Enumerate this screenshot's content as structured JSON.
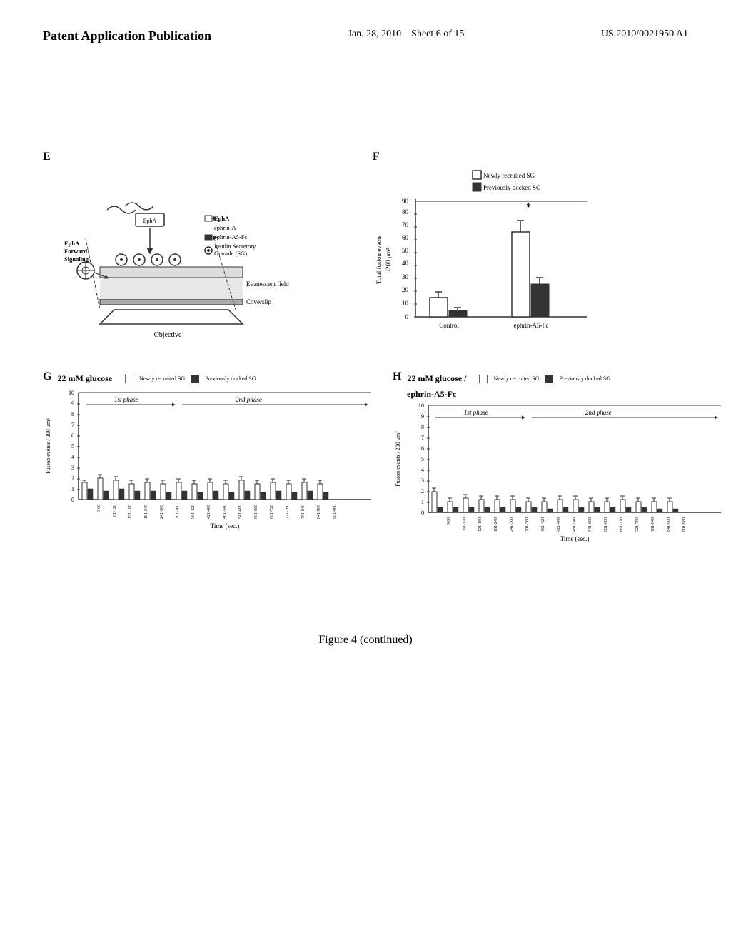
{
  "header": {
    "left": "Patent Application Publication",
    "center_date": "Jan. 28, 2010",
    "center_sheet": "Sheet 6 of 15",
    "right": "US 2010/0021950 A1"
  },
  "figure_caption": "Figure 4 (continued)",
  "panel_e": {
    "label": "E",
    "diagram_labels": {
      "epha": "EphA",
      "ephrin_a": "ephrin-A",
      "ephrin_a5_fc": "ephrin-A5-Fc",
      "insulin_sg": "Insulin Secretory\nGranule (SG)",
      "evanescent": "Evanescent field",
      "coverslip": "Coverslip",
      "objective": "Objective",
      "epha_forward": "EphA\nForward\nSignaling"
    }
  },
  "panel_f": {
    "label": "F",
    "legend": {
      "newly": "Newly recruited SG",
      "previously": "Previously docked SG"
    },
    "y_axis_label": "Total fusion events\n/ 200 μm²",
    "y_values": [
      10,
      20,
      30,
      40,
      50,
      60,
      70,
      80,
      90
    ],
    "x_labels": [
      "Control",
      "ephrin-A5-Fc"
    ],
    "asterisk": "*",
    "data": {
      "control_new": 15,
      "control_old": 5,
      "ephrin_new": 65,
      "ephrin_old": 25
    }
  },
  "panel_g": {
    "label": "G",
    "title": "22 mM glucose",
    "legend": {
      "newly": "Newly recruited SG",
      "previously": "Previously docked SG"
    },
    "y_axis_label": "Fusion events / 200 μm²",
    "y_max": 10,
    "phase1_label": "1st phase",
    "phase2_label": "2nd phase",
    "time_label": "Time (sec.)",
    "x_labels": [
      "0-60",
      "61-120",
      "121-180",
      "181-240",
      "241-300",
      "301-360",
      "361-420",
      "421-480",
      "481-540",
      "541-600",
      "601-660",
      "661-720",
      "721-780",
      "781-840",
      "841-900",
      "901-960"
    ]
  },
  "panel_h": {
    "label": "H",
    "title": "22 mM glucose /\nephrin-A5-Fc",
    "legend": {
      "newly": "Newly recruited SG",
      "previously": "Previously docked SG"
    },
    "y_axis_label": "Fusion events / 200 μm²",
    "y_max": 10,
    "phase1_label": "1st phase",
    "phase2_label": "2nd phase",
    "time_label": "Time (sec.)",
    "x_labels": [
      "0-60",
      "61-120",
      "121-180",
      "181-240",
      "241-300",
      "301-360",
      "361-420",
      "421-480",
      "481-540",
      "541-600",
      "601-660",
      "661-720",
      "721-780",
      "781-840",
      "841-900",
      "901-960"
    ]
  }
}
